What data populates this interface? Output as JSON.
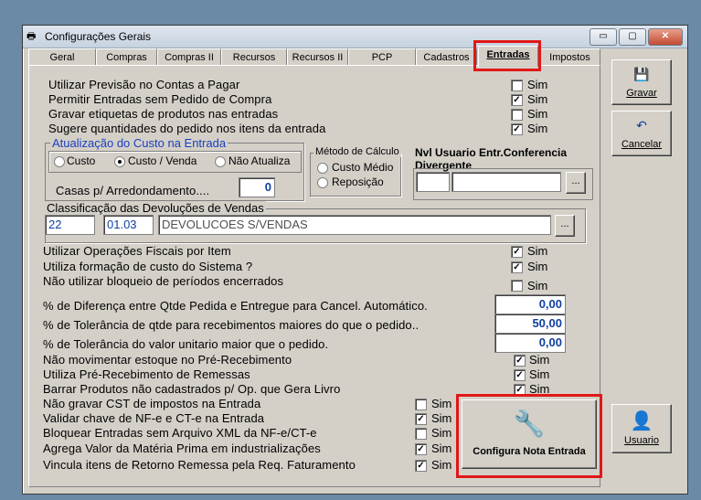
{
  "window": {
    "title": "Configurações Gerais",
    "min": "▭",
    "max": "▢",
    "close": "✕"
  },
  "tabs": [
    "Geral",
    "Compras",
    "Compras II",
    "Recursos",
    "Recursos II",
    "PCP",
    "Cadastros",
    "Entradas",
    "Impostos"
  ],
  "sim": "Sim",
  "checks_top": [
    {
      "label": "Utilizar Previsão no Contas a Pagar",
      "checked": false
    },
    {
      "label": "Permitir Entradas sem Pedido de Compra",
      "checked": true
    },
    {
      "label": "Gravar etiquetas de produtos nas entradas",
      "checked": false
    },
    {
      "label": "Sugere quantidades do pedido nos itens da entrada",
      "checked": true
    }
  ],
  "custo": {
    "title": "Atualização do Custo na Entrada",
    "options": [
      "Custo",
      "Custo / Venda",
      "Não Atualiza"
    ],
    "selected": 1
  },
  "metodo": {
    "title": "Método de Cálculo",
    "options": [
      "Custo Médio",
      "Reposição"
    ]
  },
  "nvl": {
    "line1": "Nvl Usuario Entr.Conferencia",
    "line2": "Divergente",
    "button": "..."
  },
  "casas": {
    "label": "Casas p/ Arredondamento....",
    "value": "0"
  },
  "classif": {
    "title": "Classificação das Devoluções de Vendas",
    "code1": "22",
    "code2": "01.03",
    "desc": "DEVOLUCOES S/VENDAS",
    "button": "..."
  },
  "checks_mid": [
    {
      "label": "Utilizar Operações Fiscais por Item",
      "checked": true
    },
    {
      "label": "Utiliza formação de custo do Sistema ?",
      "checked": true
    },
    {
      "label": "Não utilizar bloqueio de períodos encerrados",
      "checked": false
    }
  ],
  "percent": [
    {
      "label": "% de Diferença entre Qtde Pedida e Entregue para Cancel. Automático.",
      "value": "0,00"
    },
    {
      "label": "% de Tolerância de qtde para recebimentos maiores do que o pedido..",
      "value": "50,00"
    },
    {
      "label": "% de Tolerância do valor unitario maior que o pedido.",
      "value": "0,00"
    }
  ],
  "checks_low": [
    {
      "label": "Não movimentar estoque no Pré-Recebimento",
      "checked": true
    },
    {
      "label": "Utiliza Pré-Recebimento de Remessas",
      "checked": true
    },
    {
      "label": "Barrar Produtos não cadastrados p/ Op. que Gera Livro",
      "checked": true
    }
  ],
  "checks_bottom": [
    {
      "label": "Não gravar CST de impostos na Entrada",
      "checked": false
    },
    {
      "label": "Validar chave de NF-e e CT-e na Entrada",
      "checked": true
    },
    {
      "label": "Bloquear Entradas sem Arquivo XML da NF-e/CT-e",
      "checked": false
    },
    {
      "label": "Agrega Valor da Matéria Prima em industrializações",
      "checked": true
    },
    {
      "label": "Vincula itens de Retorno Remessa pela Req. Faturamento",
      "checked": true
    }
  ],
  "buttons": {
    "gravar": "Gravar",
    "cancelar": "Cancelar",
    "usuario": "Usuario",
    "configura": "Configura Nota Entrada"
  },
  "colors": {
    "highlight": "#e01818",
    "value_text": "#1040a0",
    "group_title": "#1a3fbf"
  }
}
